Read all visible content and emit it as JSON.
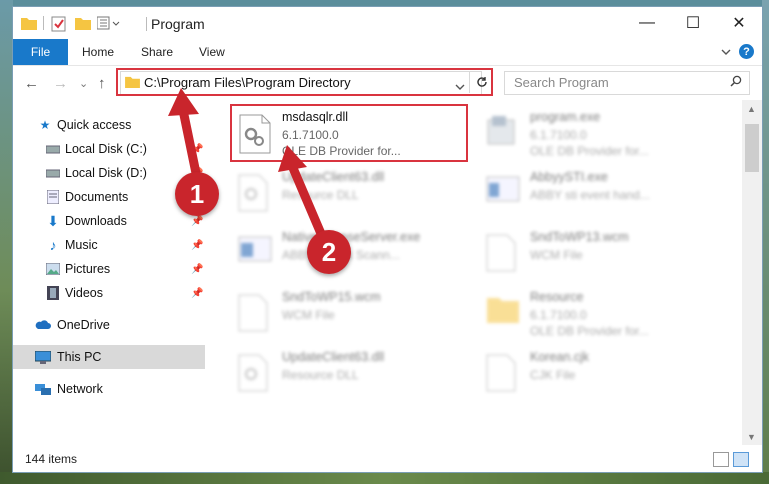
{
  "window": {
    "title": "Program",
    "controls": {
      "minimize": "—",
      "maximize": "☐",
      "close": "✕"
    }
  },
  "ribbon": {
    "tabs": [
      {
        "label": "File"
      },
      {
        "label": "Home"
      },
      {
        "label": "Share"
      },
      {
        "label": "View"
      }
    ],
    "help": "?"
  },
  "nav": {
    "back": "←",
    "forward": "→",
    "recent": "⌄",
    "up": "↑",
    "address": "C:\\Program Files\\Program Directory",
    "search_placeholder": "Search Program"
  },
  "sidebar": {
    "items": [
      {
        "label": "Quick access",
        "icon": "star-icon"
      },
      {
        "label": "Local Disk (C:)",
        "icon": "drive-icon"
      },
      {
        "label": "Local Disk (D:)",
        "icon": "drive-icon"
      },
      {
        "label": "Documents",
        "icon": "documents-icon"
      },
      {
        "label": "Downloads",
        "icon": "downloads-icon"
      },
      {
        "label": "Music",
        "icon": "music-icon"
      },
      {
        "label": "Pictures",
        "icon": "pictures-icon"
      },
      {
        "label": "Videos",
        "icon": "videos-icon"
      },
      {
        "label": "OneDrive",
        "icon": "cloud-icon"
      },
      {
        "label": "This PC",
        "icon": "computer-icon"
      },
      {
        "label": "Network",
        "icon": "network-icon"
      }
    ]
  },
  "files": [
    {
      "name": "msdasqlr.dll",
      "line1": "6.1.7100.0",
      "line2": "OLE DB Provider for..."
    },
    {
      "name": "program.exe",
      "line1": "6.1.7100.0",
      "line2": "OLE DB Provider for..."
    },
    {
      "name": "UpdateClient63.dll",
      "line1": "Resource DLL",
      "line2": ""
    },
    {
      "name": "AbbyySTI.exe",
      "line1": "ABBY sti event hand...",
      "line2": ""
    },
    {
      "name": "NativeLicenseServer.exe",
      "line1": "ABBYY Book Scann...",
      "line2": ""
    },
    {
      "name": "SndToWP13.wcm",
      "line1": "WCM File",
      "line2": ""
    },
    {
      "name": "SndToWP15.wcm",
      "line1": "WCM File",
      "line2": ""
    },
    {
      "name": "Resource",
      "line1": "6.1.7100.0",
      "line2": "OLE DB Provider for..."
    },
    {
      "name": "UpdateClient63.dll",
      "line1": "Resource DLL",
      "line2": ""
    },
    {
      "name": "Korean.cjk",
      "line1": "CJK File",
      "line2": ""
    }
  ],
  "status": {
    "count": "144 items"
  },
  "annotations": {
    "step1": "1",
    "step2": "2"
  },
  "colors": {
    "accent": "#1979ca",
    "highlight": "#d9343f",
    "badge": "#c9252c"
  }
}
